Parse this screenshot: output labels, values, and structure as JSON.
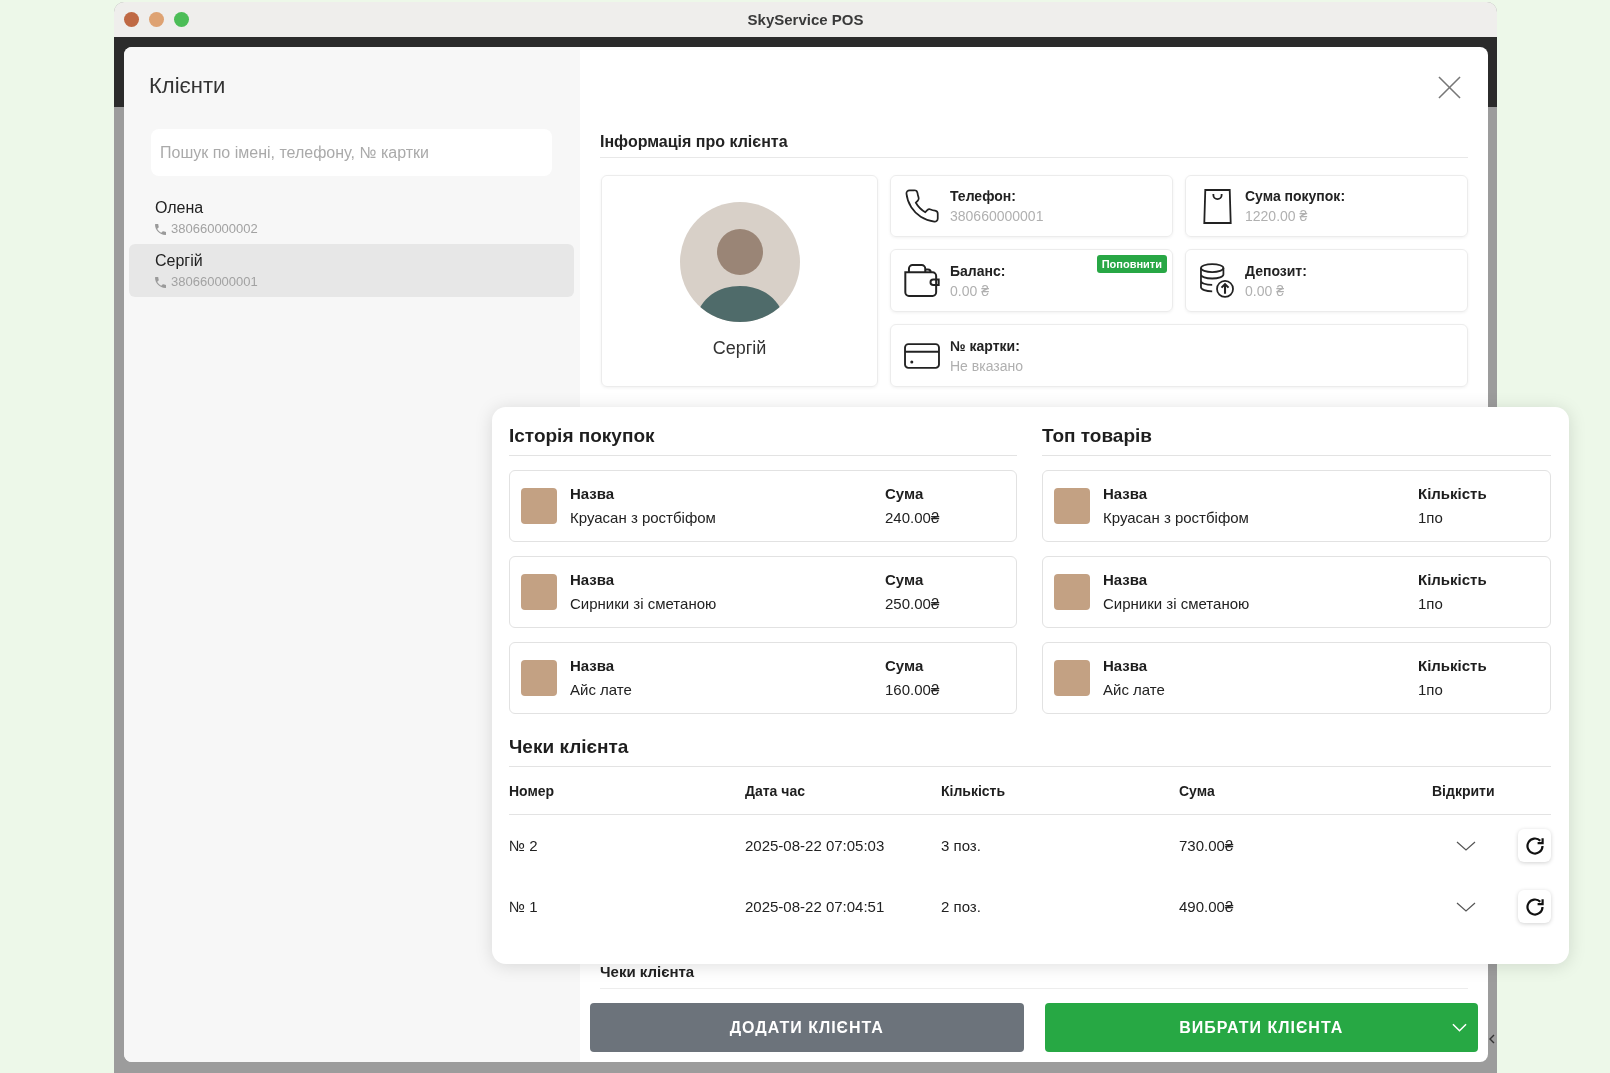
{
  "window": {
    "title": "SkyService POS"
  },
  "clients": {
    "title": "Клієнти",
    "search": {
      "placeholder": "Пошук по імені, телефону, № картки"
    },
    "items": [
      {
        "name": "Олена",
        "phone": "380660000002",
        "selected": false
      },
      {
        "name": "Сергій",
        "phone": "380660000001",
        "selected": true
      }
    ]
  },
  "client_info": {
    "title": "Інформація про клієнта",
    "name": "Сергій",
    "fields": [
      {
        "kind": "phone",
        "label": "Телефон:",
        "value": "380660000001"
      },
      {
        "kind": "purchases",
        "label": "Сума покупок:",
        "value": "1220.00 ₴"
      },
      {
        "kind": "balance",
        "label": "Баланс:",
        "value": "0.00 ₴",
        "action": "Поповнити"
      },
      {
        "kind": "deposit",
        "label": "Депозит:",
        "value": "0.00 ₴"
      },
      {
        "kind": "card",
        "label": "№ картки:",
        "value": "Не вказано"
      }
    ]
  },
  "details_popup": {
    "purchase_history": {
      "title": "Історія покупок",
      "items": [
        {
          "name_label": "Назва",
          "name": "Круасан з ростбіфом",
          "amount_label": "Сума",
          "amount": "240.00₴"
        },
        {
          "name_label": "Назва",
          "name": "Сирники зі сметаною",
          "amount_label": "Сума",
          "amount": "250.00₴"
        },
        {
          "name_label": "Назва",
          "name": "Айс лате",
          "amount_label": "Сума",
          "amount": "160.00₴"
        }
      ]
    },
    "top_products": {
      "title": "Топ товарів",
      "items": [
        {
          "name_label": "Назва",
          "name": "Круасан з ростбіфом",
          "quantity_label": "Кількість",
          "quantity": "1по"
        },
        {
          "name_label": "Назва",
          "name": "Сирники зі сметаною",
          "quantity_label": "Кількість",
          "quantity": "1по"
        },
        {
          "name_label": "Назва",
          "name": "Айс лате",
          "quantity_label": "Кількість",
          "quantity": "1по"
        }
      ]
    },
    "receipts": {
      "title": "Чеки клієнта",
      "columns": [
        "Номер",
        "Дата час",
        "Кількість",
        "Сума",
        "Відкрити"
      ],
      "rows": [
        {
          "number": "№ 2",
          "datetime": "2025-08-22 07:05:03",
          "quantity": "3 поз.",
          "amount": "730.00₴",
          "expanded": false
        },
        {
          "number": "№ 1",
          "datetime": "2025-08-22 07:04:51",
          "quantity": "2 поз.",
          "amount": "490.00₴",
          "expanded": false
        }
      ]
    }
  },
  "receipts_section": {
    "title": "Чеки клієнта"
  },
  "buttons": [
    {
      "kind": "secondary",
      "label": "ДОДАТИ КЛІЄНТА"
    },
    {
      "kind": "primary",
      "label": "ВИБРАТИ КЛІЄНТА",
      "dropdown": true
    }
  ]
}
